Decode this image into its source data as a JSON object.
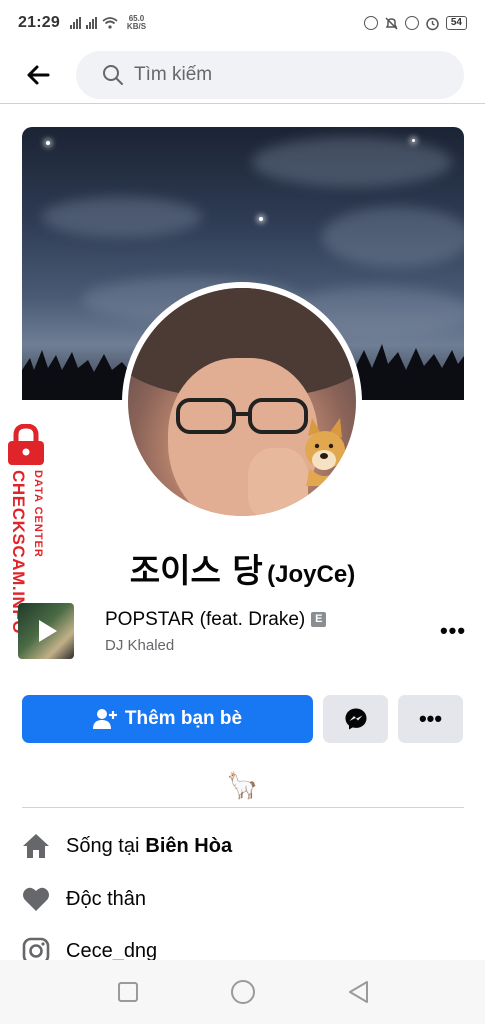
{
  "status_bar": {
    "time": "21:29",
    "net_speed_value": "65.0",
    "net_speed_unit": "KB/S",
    "battery": "54"
  },
  "top_nav": {
    "search_placeholder": "Tìm kiếm"
  },
  "profile": {
    "name": "조이스 당",
    "alt_name": "(JoyCe)"
  },
  "music": {
    "title": "POPSTAR (feat. Drake)",
    "explicit_badge": "E",
    "artist": "DJ Khaled",
    "more_label": "•••"
  },
  "actions": {
    "add_friend_label": "Thêm bạn bè",
    "more_label": "•••"
  },
  "bio": {
    "emoji": "🦙"
  },
  "details": [
    {
      "prefix": "Sống tại",
      "value": "Biên Hòa",
      "icon": "home-icon"
    },
    {
      "prefix": "Độc thân",
      "value": "",
      "icon": "heart-icon"
    },
    {
      "prefix": "Cece_dng",
      "value": "",
      "icon": "instagram-icon"
    }
  ],
  "watermark": {
    "line1": "DATA CENTER",
    "line2": "CHECKSCAM.INFO"
  },
  "colors": {
    "primary": "#1877f2",
    "secondary_button": "#e4e6eb",
    "search_bg": "#f0f2f5",
    "secondary_text": "#65676b",
    "watermark_red": "#e0252a"
  }
}
